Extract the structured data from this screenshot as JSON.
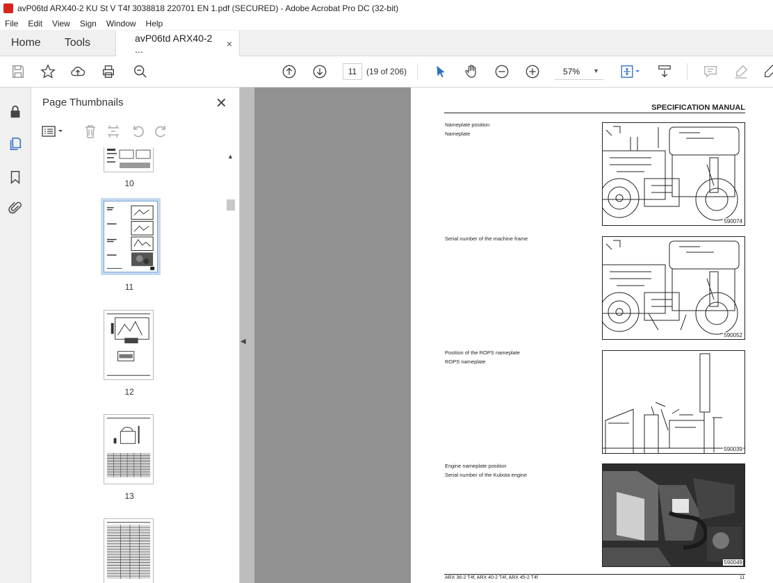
{
  "window": {
    "title": "avP06td ARX40-2 KU St V T4f 3038818 220701 EN 1.pdf (SECURED) - Adobe Acrobat Pro DC (32-bit)"
  },
  "menu": [
    "File",
    "Edit",
    "View",
    "Sign",
    "Window",
    "Help"
  ],
  "tabs": {
    "home": "Home",
    "tools": "Tools",
    "doc": "avP06td ARX40-2 ...",
    "doc_close": "×"
  },
  "toolbar": {
    "current_page": "11",
    "page_of": "(19 of 206)",
    "zoom": "57%"
  },
  "panel": {
    "title": "Page Thumbnails",
    "thumbnails": [
      {
        "label": "10"
      },
      {
        "label": "11",
        "selected": true
      },
      {
        "label": "12"
      },
      {
        "label": "13"
      },
      {
        "label": ""
      }
    ]
  },
  "document": {
    "header": "SPECIFICATION MANUAL",
    "sections": [
      {
        "caption_1": "Nameplate position",
        "caption_2": "Nameplate",
        "figure": "590074"
      },
      {
        "caption_1": "Serial number of the machine frame",
        "caption_2": "",
        "figure": "590052"
      },
      {
        "caption_1": "Position of the ROPS nameplate",
        "caption_2": "ROPS nameplate",
        "figure": "590039"
      },
      {
        "caption_1": "Engine nameplate position",
        "caption_2": "Serial number of the Kubota engine",
        "figure": "590049"
      }
    ],
    "footer": "ARX 36-2 T4f, ARX 40-2 T4f, ARX 45-2 T4f",
    "page_number": "11"
  },
  "colors": {
    "accent": "#2c6fc9",
    "selected_thumb": "#c4d9ee",
    "doc_bg": "#919191"
  }
}
